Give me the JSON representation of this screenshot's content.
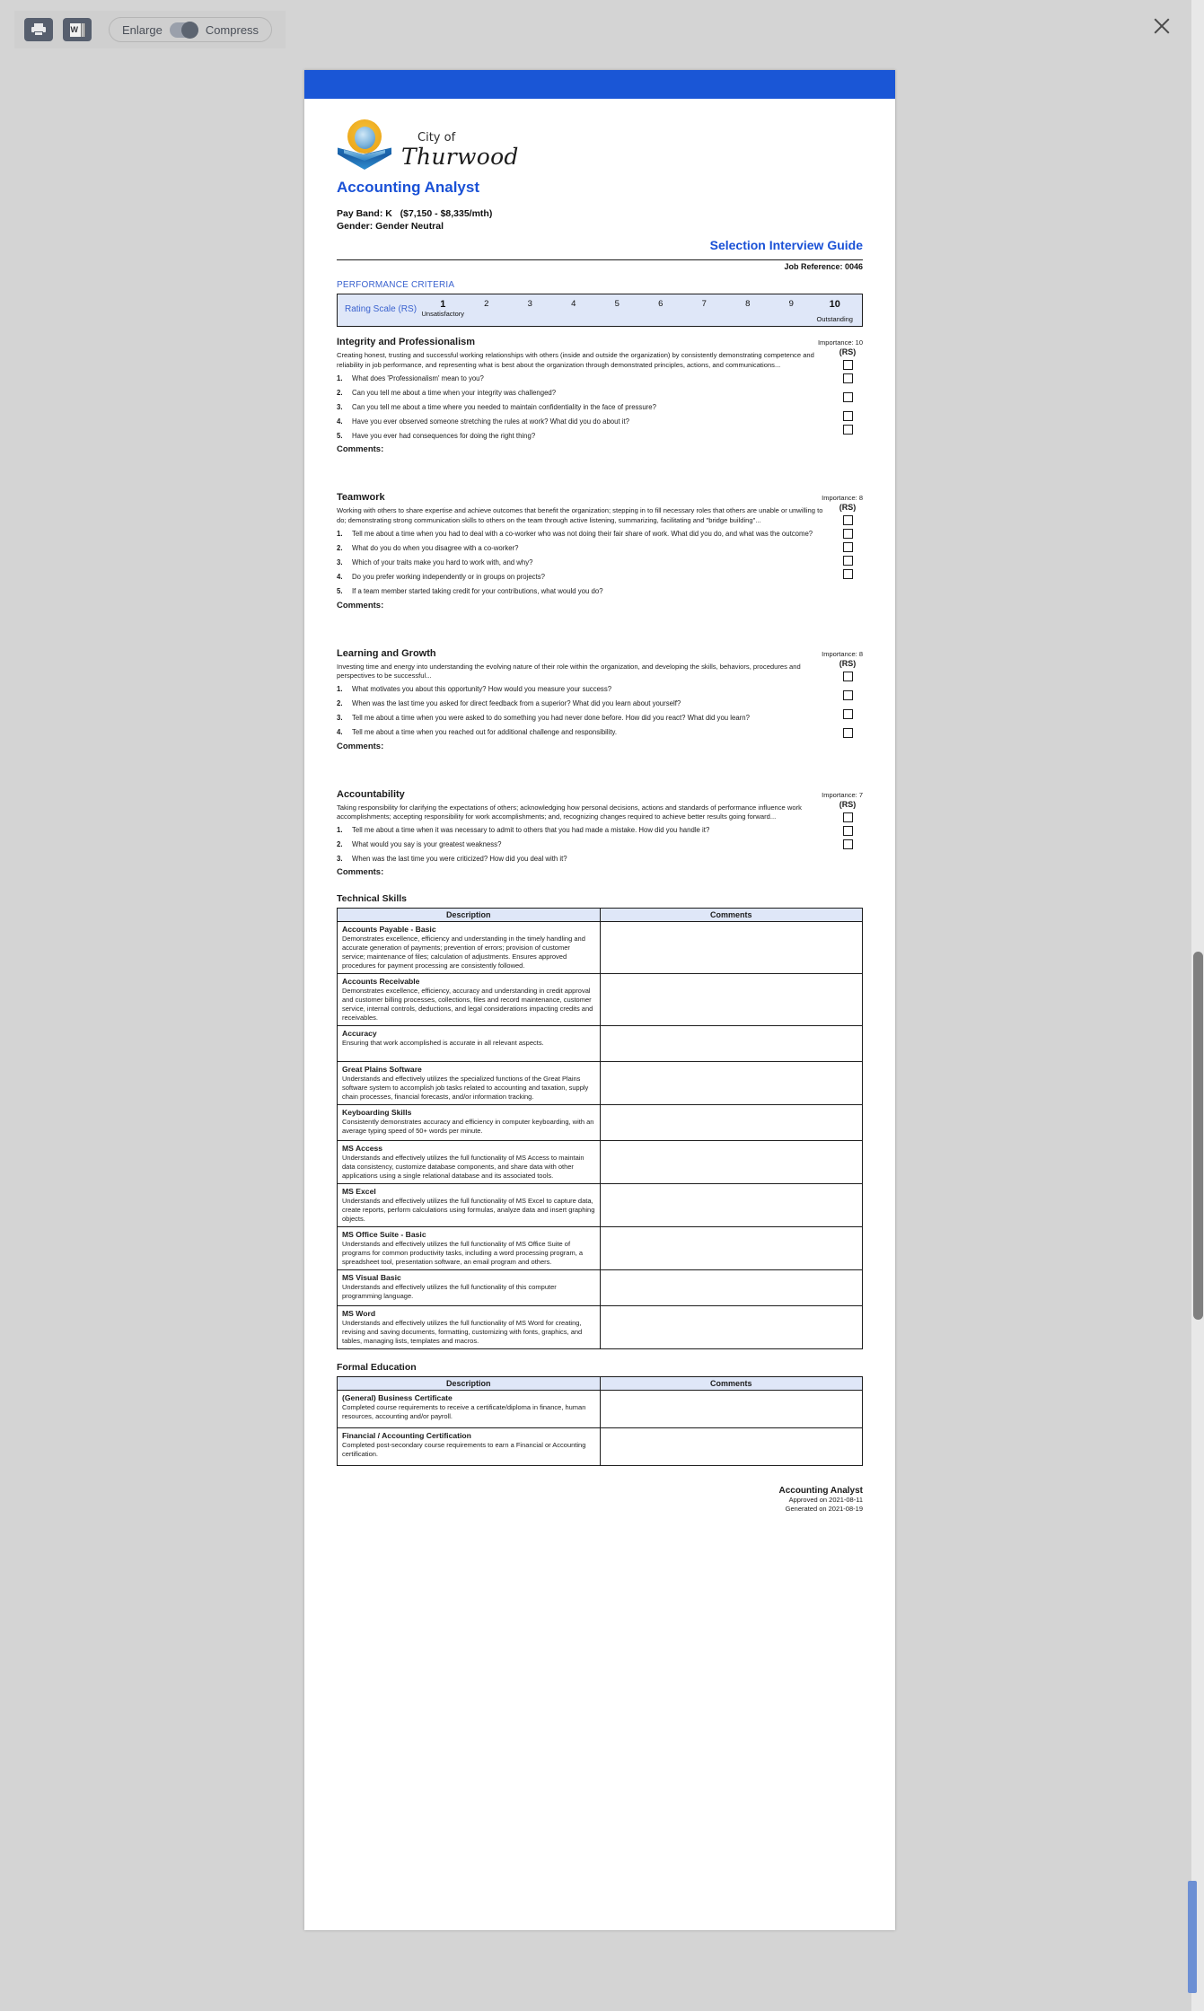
{
  "toolbar": {
    "print_label": "print",
    "word_label": "W",
    "enlarge_label": "Enlarge",
    "compress_label": "Compress",
    "close_label": "×"
  },
  "document": {
    "org_line1": "City of",
    "org_line2": "Thurwood",
    "job_title": "Accounting Analyst",
    "pay_band": "Pay Band: K",
    "pay_range": "($7,150 - $8,335/mth)",
    "gender": "Gender: Gender Neutral",
    "guide_title": "Selection Interview Guide",
    "job_reference": "Job Reference: 0046",
    "performance_criteria_label": "PERFORMANCE CRITERIA",
    "rating_scale_label": "Rating Scale (RS)",
    "rating_scale_values": [
      "1",
      "2",
      "3",
      "4",
      "5",
      "6",
      "7",
      "8",
      "9",
      "10"
    ],
    "rating_low_caption": "Unsatisfactory",
    "rating_high_caption": "Outstanding",
    "rs_column_header": "(RS)",
    "comments_label": "Comments:",
    "competencies": [
      {
        "title": "Integrity and Professionalism",
        "importance": "Importance: 10",
        "description": "Creating honest, trusting and successful working relationships with others (inside and outside the organization) by consistently demonstrating competence and reliability in job performance, and representing what is best about the organization through demonstrated principles, actions, and communications...",
        "questions": [
          "What does 'Professionalism' mean to you?",
          "Can you tell me about a time when your integrity was challenged?",
          "Can you tell me about a time where you needed to maintain confidentiality in the face of pressure?",
          "Have you ever observed someone stretching the rules at work? What did you do about it?",
          "Have you ever had consequences for doing the right thing?"
        ]
      },
      {
        "title": "Teamwork",
        "importance": "Importance: 8",
        "description": "Working with others to share expertise and achieve outcomes that benefit the organization; stepping in to fill necessary roles that others are unable or unwilling to do; demonstrating strong communication skills to others on the team through active listening, summarizing, facilitating and \"bridge building\"...",
        "questions": [
          "Tell me about a time when you had to deal with a co-worker who was not doing their fair share of work. What did you do, and what was the outcome?",
          "What do you do when you disagree with a co-worker?",
          "Which of your traits make you hard to work with, and why?",
          "Do you prefer working independently or in groups on projects?",
          "If a team member started taking credit for your contributions, what would you do?"
        ]
      },
      {
        "title": "Learning and Growth",
        "importance": "Importance: 8",
        "description": "Investing time and energy into understanding the evolving nature of their role within the organization, and developing the skills, behaviors, procedures and perspectives to be successful...",
        "questions": [
          "What motivates you about this opportunity? How would you measure your success?",
          "When was the last time you asked for direct feedback from a superior? What did you learn about yourself?",
          "Tell me about a time when you were asked to do something you had never done before. How did you react? What did you learn?",
          "Tell me about a time when you reached out for additional challenge and responsibility."
        ]
      },
      {
        "title": "Accountability",
        "importance": "Importance: 7",
        "description": "Taking responsibility for clarifying the expectations of others; acknowledging how personal decisions, actions and standards of performance influence work accomplishments; accepting responsibility for work accomplishments; and, recognizing changes required to achieve better results going forward...",
        "questions": [
          "Tell me about a time when it was necessary to admit to others that you had made a mistake. How did you handle it?",
          "What would you say is your greatest weakness?",
          "When was the last time you were criticized? How did you deal with it?"
        ]
      }
    ],
    "technical_skills": {
      "title": "Technical Skills",
      "columns": [
        "Description",
        "Comments"
      ],
      "rows": [
        {
          "name": "Accounts Payable - Basic",
          "desc": "Demonstrates excellence, efficiency and understanding in the timely handling and accurate generation of payments; prevention of errors; provision of customer service; maintenance of files; calculation of adjustments. Ensures approved procedures for payment processing are consistently followed.",
          "comment": ""
        },
        {
          "name": "Accounts Receivable",
          "desc": "Demonstrates excellence, efficiency, accuracy and understanding in credit approval and customer billing processes, collections, files and record maintenance, customer service, internal controls, deductions, and legal considerations impacting credits and receivables.",
          "comment": ""
        },
        {
          "name": "Accuracy",
          "desc": "Ensuring that work accomplished is accurate in all relevant aspects.",
          "comment": ""
        },
        {
          "name": "Great Plains Software",
          "desc": "Understands and effectively utilizes the specialized functions of the Great Plains software system to accomplish job tasks related to accounting and taxation, supply chain processes, financial forecasts, and/or information tracking.",
          "comment": ""
        },
        {
          "name": "Keyboarding Skills",
          "desc": "Consistently demonstrates accuracy and efficiency in computer keyboarding, with an average typing speed of 50+ words per minute.",
          "comment": ""
        },
        {
          "name": "MS Access",
          "desc": "Understands and effectively utilizes the full functionality of MS Access to maintain data consistency, customize database components, and share data with other applications using a single relational database and its associated tools.",
          "comment": ""
        },
        {
          "name": "MS Excel",
          "desc": "Understands and effectively utilizes the full functionality of MS Excel to capture data, create reports, perform calculations using formulas, analyze data and insert graphing objects.",
          "comment": ""
        },
        {
          "name": "MS Office Suite - Basic",
          "desc": "Understands and effectively utilizes the full functionality of MS Office Suite of programs for common productivity tasks, including a word processing program, a spreadsheet tool, presentation software, an email program and others.",
          "comment": ""
        },
        {
          "name": "MS Visual Basic",
          "desc": "Understands and effectively utilizes the full functionality of this computer programming language.",
          "comment": ""
        },
        {
          "name": "MS Word",
          "desc": "Understands and effectively utilizes the full functionality of MS Word for creating, revising and saving documents, formatting, customizing with fonts, graphics, and tables, managing lists, templates and macros.",
          "comment": ""
        }
      ]
    },
    "formal_education": {
      "title": "Formal Education",
      "columns": [
        "Description",
        "Comments"
      ],
      "rows": [
        {
          "name": "(General) Business Certificate",
          "desc": "Completed course requirements to receive a certificate/diploma in finance, human resources, accounting and/or payroll.",
          "comment": ""
        },
        {
          "name": "Financial / Accounting Certification",
          "desc": "Completed post-secondary course requirements to earn a Financial or Accounting certification.",
          "comment": ""
        }
      ]
    },
    "footer": {
      "title": "Accounting Analyst",
      "approved": "Approved on 2021-08-11",
      "generated": "Generated on 2021-08-19"
    }
  },
  "colors": {
    "brand_blue": "#1a51d6",
    "page_bar": "#1a56d6",
    "table_header": "#dfe7f8",
    "scroll_thumb": "#6c8fd4"
  }
}
